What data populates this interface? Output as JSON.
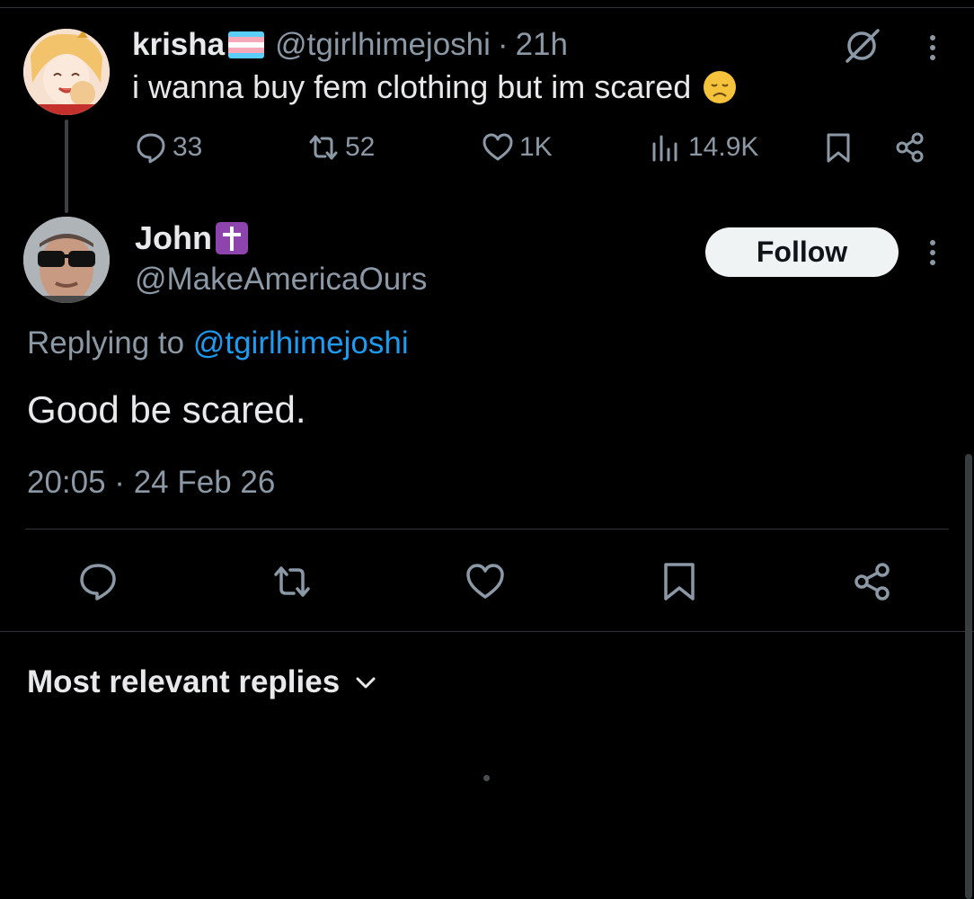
{
  "parent_tweet": {
    "display_name": "krisha",
    "flag_icon": "trans-flag-icon",
    "handle": "@tgirlhimejoshi",
    "separator": "·",
    "time_ago": "21h",
    "text": "i wanna buy fem clothing but im scared",
    "emoji_icon": "disappointed-face-icon",
    "stats": {
      "replies": "33",
      "reposts": "52",
      "likes": "1K",
      "views": "14.9K"
    }
  },
  "reply_tweet": {
    "display_name": "John",
    "badge_icon": "latin-cross-icon",
    "handle": "@MakeAmericaOurs",
    "follow_label": "Follow",
    "replying_prefix": "Replying to ",
    "replying_to": "@tgirlhimejoshi",
    "text": "Good be scared.",
    "timestamp": "20:05 · 24 Feb 26"
  },
  "replies_sort": {
    "label": "Most relevant replies"
  },
  "colors": {
    "background": "#000000",
    "text_primary": "#e7e9ea",
    "text_secondary": "#8b98a5",
    "link": "#1d9bf0",
    "divider": "#2f3336",
    "follow_button_bg": "#eff3f4"
  }
}
